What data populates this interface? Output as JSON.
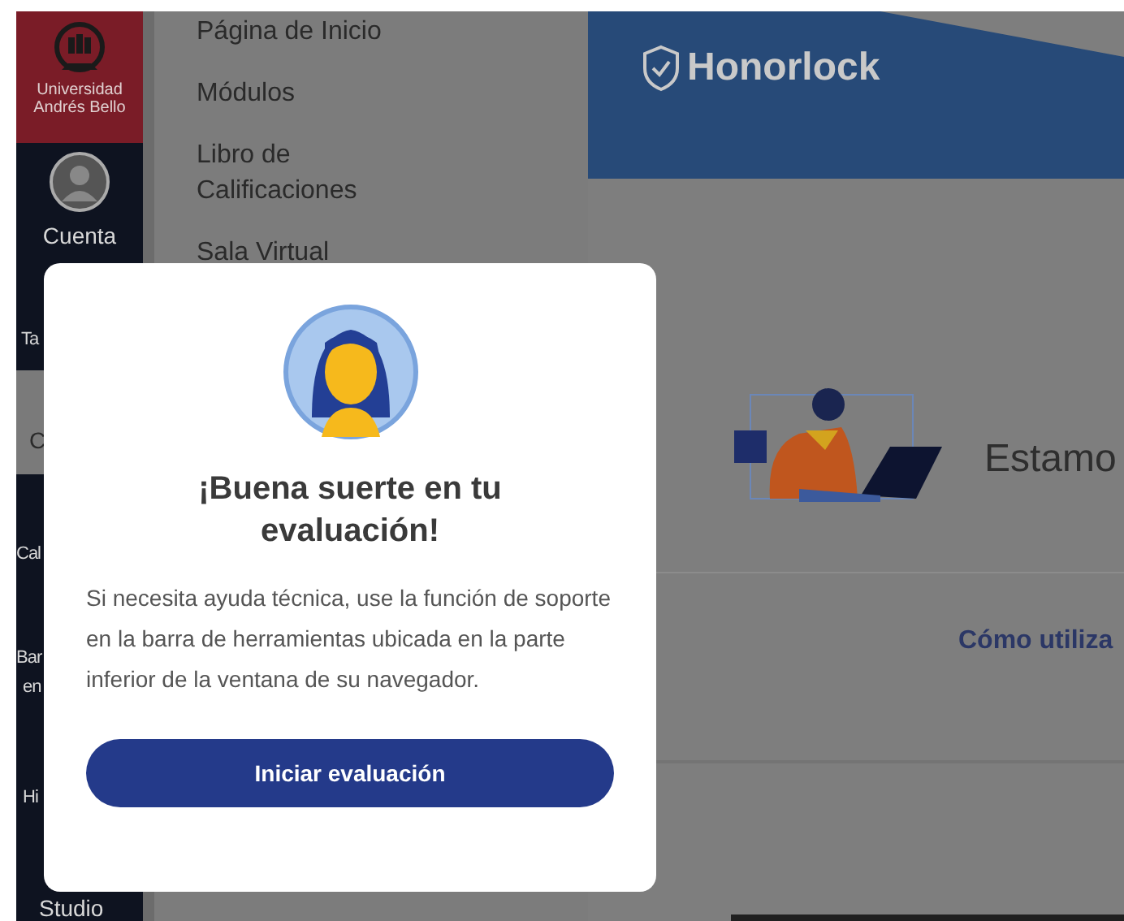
{
  "sidebar": {
    "logo": {
      "lines": [
        "Universidad",
        "Andrés Bello"
      ]
    },
    "account": {
      "label": "Cuenta"
    },
    "items": [
      {
        "lines": [
          "Ta"
        ],
        "selected": false
      },
      {
        "lines": [
          "C"
        ],
        "selected": true
      },
      {
        "lines": [
          "Cal"
        ],
        "selected": false
      },
      {
        "lines": [
          "Bar",
          "en"
        ],
        "selected": false
      },
      {
        "lines": [
          "Hi"
        ],
        "selected": false
      },
      {
        "lines": [
          "Studio"
        ],
        "selected": false
      }
    ]
  },
  "course_menu": {
    "items": [
      {
        "lines": [
          "Página de Inicio"
        ]
      },
      {
        "lines": [
          "Módulos"
        ]
      },
      {
        "lines": [
          "Libro de",
          "Calificaciones"
        ]
      },
      {
        "lines": [
          "Sala Virtual"
        ]
      }
    ]
  },
  "honorlock": {
    "brand": "Honorlock",
    "heading": "Estamo",
    "link": "Cómo utiliza"
  },
  "modal": {
    "title": "¡Buena suerte en tu evaluación!",
    "body": "Si necesita ayuda técnica, use la función de soporte en la barra de herramientas ubicada en la parte inferior de la ventana de su navegador.",
    "button": "Iniciar evaluación"
  }
}
